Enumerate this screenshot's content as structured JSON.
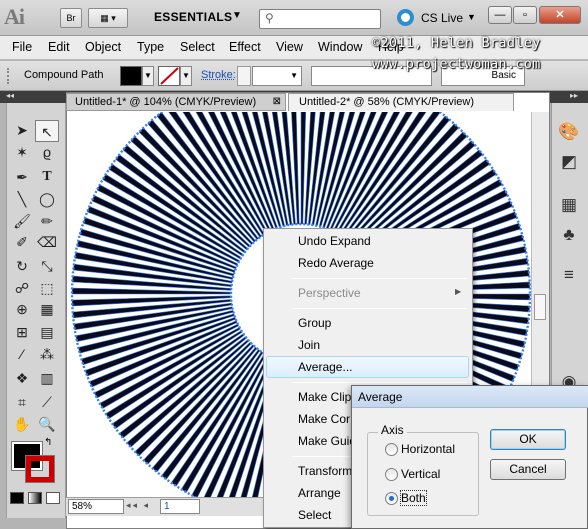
{
  "appbar": {
    "logo": "Ai",
    "bridge_button": "Br",
    "workspace": "ESSENTIALS",
    "cs_live": "CS Live",
    "minimize": "—",
    "restore": "▫",
    "close": "✕"
  },
  "watermark": {
    "line1": "©2011, Helen Bradley",
    "line2": "www.projectwoman.com"
  },
  "menubar": {
    "items": [
      "File",
      "Edit",
      "Object",
      "Type",
      "Select",
      "Effect",
      "View",
      "Window",
      "Help"
    ]
  },
  "controlbar": {
    "selection_label": "Compound Path",
    "stroke_label": "Stroke:",
    "brush_label": "Basic"
  },
  "documents": {
    "tab1": "Untitled-1* @ 104% (CMYK/Preview)",
    "tab2": "Untitled-2* @ 58% (CMYK/Preview)",
    "close_glyph": "⊠"
  },
  "statusbar": {
    "zoom": "58%",
    "page": "1"
  },
  "context_menu": {
    "items": [
      "Undo Expand",
      "Redo Average",
      "Perspective",
      "Group",
      "Join",
      "Average...",
      "Make Clip",
      "Make Cor",
      "Make Guid",
      "Transform",
      "Arrange",
      "Select"
    ],
    "disabled": [
      "Perspective"
    ],
    "highlighted": "Average..."
  },
  "dialog": {
    "title": "Average",
    "group_label": "Axis",
    "options": [
      "Horizontal",
      "Vertical",
      "Both"
    ],
    "selected": "Both",
    "ok": "OK",
    "cancel": "Cancel"
  },
  "colors": {
    "accent_blue": "#3b7df0",
    "stroke_red": "#cc0000"
  }
}
